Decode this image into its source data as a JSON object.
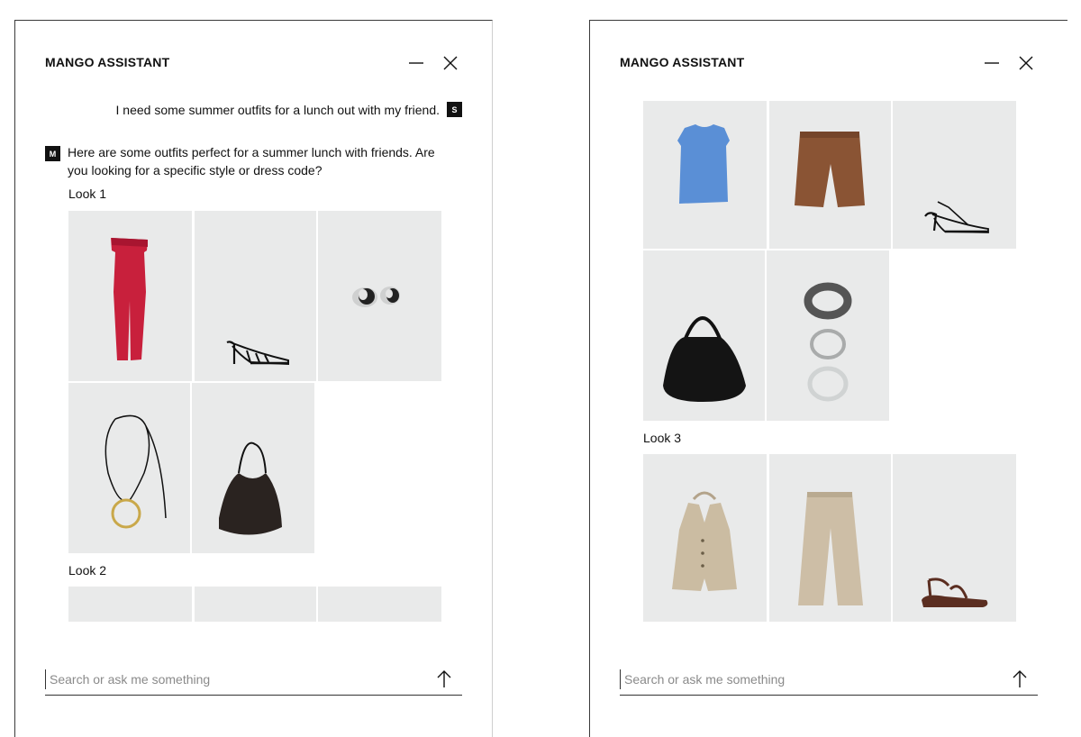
{
  "assistant": {
    "title": "MANGO ASSISTANT",
    "user_avatar": "S",
    "assistant_avatar": "M",
    "user_message": "I need some summer outfits for a lunch out with my friend.",
    "assistant_message": "Here are some outfits perfect for a summer lunch with friends. Are you looking for a specific style or dress code?",
    "search_placeholder": "Search or ask me something"
  },
  "looks": [
    {
      "label": "Look 1",
      "items": [
        "red-jumpsuit",
        "strappy-heel-sandal",
        "silver-earrings",
        "cord-pendant-necklace",
        "black-shoulder-bag"
      ]
    },
    {
      "label": "Look 2",
      "items": [
        "blue-sleeveless-top",
        "brown-shorts",
        "strappy-kitten-heel",
        "black-woven-bag",
        "bangle-set"
      ]
    },
    {
      "label": "Look 3",
      "items": [
        "beige-halter-waistcoat",
        "beige-wide-trousers",
        "brown-flat-sandal"
      ]
    }
  ],
  "icons": {
    "minimize": "minimize-icon",
    "close": "close-icon",
    "send": "arrow-up-icon"
  }
}
